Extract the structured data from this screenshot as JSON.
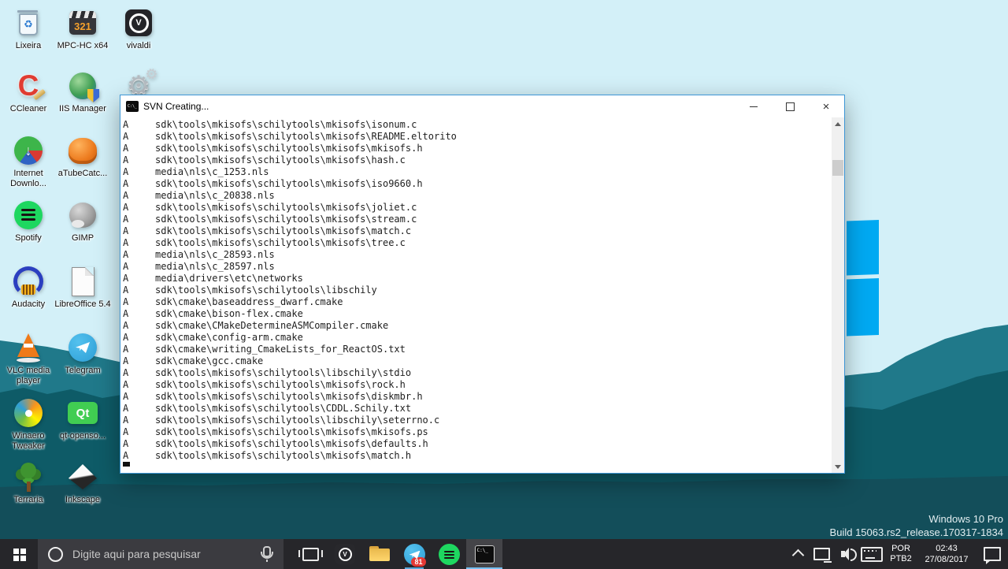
{
  "colors": {
    "sky": "#d3f0f8",
    "hill": "#20798a",
    "forest": "#0e5b67",
    "base": "#134e5a",
    "logo_blue": "#00a9f2",
    "taskbar": "#26262a",
    "window_border": "#3f97d6",
    "badge_red": "#e53935",
    "active_underline": "#76c0f2"
  },
  "desktop": {
    "icons": [
      {
        "id": "lixeira",
        "kind": "bin",
        "col": 0,
        "row": 0,
        "label": "Lixeira",
        "g1": "♻",
        "g2": ""
      },
      {
        "id": "mpc-hc",
        "kind": "clapper",
        "col": 1,
        "row": 0,
        "label": "MPC-HC x64",
        "g1": "",
        "g2": "321"
      },
      {
        "id": "vivaldi",
        "kind": "vivaldi",
        "col": 2,
        "row": 0,
        "label": "vivaldi",
        "g1": "",
        "g2": "V"
      },
      {
        "id": "ccleaner",
        "kind": "ccleaner",
        "col": 0,
        "row": 1,
        "label": "CCleaner",
        "g1": "C",
        "g2": ""
      },
      {
        "id": "iis-manager",
        "kind": "iis",
        "col": 1,
        "row": 1,
        "label": "IIS Manager",
        "g1": "",
        "g2": ""
      },
      {
        "id": "unknown-gears-app",
        "kind": "gears",
        "col": 2,
        "row": 1,
        "label": "",
        "g1": "⚙",
        "g2": "⚙"
      },
      {
        "id": "internet-download",
        "kind": "idm",
        "col": 0,
        "row": 2,
        "label": "Internet Downlo...",
        "g1": "",
        "g2": "↓"
      },
      {
        "id": "atubecatcher",
        "kind": "fist",
        "col": 1,
        "row": 2,
        "label": "aTubeCatc...",
        "g1": "",
        "g2": ""
      },
      {
        "id": "spotify",
        "kind": "spotify",
        "col": 0,
        "row": 3,
        "label": "Spotify",
        "g1": "",
        "g2": ""
      },
      {
        "id": "gimp",
        "kind": "gimp",
        "col": 1,
        "row": 3,
        "label": "GIMP",
        "g1": "",
        "g2": ""
      },
      {
        "id": "audacity",
        "kind": "audacity",
        "col": 0,
        "row": 4,
        "label": "Audacity",
        "g1": "",
        "g2": ""
      },
      {
        "id": "libreoffice",
        "kind": "lodoc",
        "col": 1,
        "row": 4,
        "label": "LibreOffice 5.4",
        "g1": "",
        "g2": ""
      },
      {
        "id": "vlc",
        "kind": "vlc",
        "col": 0,
        "row": 5,
        "label": "VLC media player",
        "g1": "",
        "g2": ""
      },
      {
        "id": "telegram",
        "kind": "telegram",
        "col": 1,
        "row": 5,
        "label": "Telegram",
        "g1": "",
        "g2": ""
      },
      {
        "id": "winaero-tweaker",
        "kind": "winaero",
        "col": 0,
        "row": 6,
        "label": "Winaero Tweaker",
        "g1": "",
        "g2": ""
      },
      {
        "id": "qt-opensource",
        "kind": "qt",
        "col": 1,
        "row": 6,
        "label": "qt-openso...",
        "g1": "",
        "g2": "Qt"
      },
      {
        "id": "terraria",
        "kind": "terraria",
        "col": 0,
        "row": 7,
        "label": "Terraria",
        "g1": "",
        "g2": ""
      },
      {
        "id": "inkscape",
        "kind": "inkscape",
        "col": 1,
        "row": 7,
        "label": "Inkscape",
        "g1": "",
        "g2": ""
      }
    ],
    "watermark": {
      "line1": "Windows 10 Pro",
      "line2": "Build 15063.rs2_release.170317-1834"
    }
  },
  "window": {
    "title": "SVN Creating...",
    "cmd_glyph": "C:\\_",
    "close_glyph": "×",
    "lines": [
      {
        "s": "A",
        "p": "sdk\\tools\\mkisofs\\schilytools\\mkisofs\\isonum.c"
      },
      {
        "s": "A",
        "p": "sdk\\tools\\mkisofs\\schilytools\\mkisofs\\README.eltorito"
      },
      {
        "s": "A",
        "p": "sdk\\tools\\mkisofs\\schilytools\\mkisofs\\mkisofs.h"
      },
      {
        "s": "A",
        "p": "sdk\\tools\\mkisofs\\schilytools\\mkisofs\\hash.c"
      },
      {
        "s": "A",
        "p": "media\\nls\\c_1253.nls"
      },
      {
        "s": "A",
        "p": "sdk\\tools\\mkisofs\\schilytools\\mkisofs\\iso9660.h"
      },
      {
        "s": "A",
        "p": "media\\nls\\c_20838.nls"
      },
      {
        "s": "A",
        "p": "sdk\\tools\\mkisofs\\schilytools\\mkisofs\\joliet.c"
      },
      {
        "s": "A",
        "p": "sdk\\tools\\mkisofs\\schilytools\\mkisofs\\stream.c"
      },
      {
        "s": "A",
        "p": "sdk\\tools\\mkisofs\\schilytools\\mkisofs\\match.c"
      },
      {
        "s": "A",
        "p": "sdk\\tools\\mkisofs\\schilytools\\mkisofs\\tree.c"
      },
      {
        "s": "A",
        "p": "media\\nls\\c_28593.nls"
      },
      {
        "s": "A",
        "p": "media\\nls\\c_28597.nls"
      },
      {
        "s": "A",
        "p": "media\\drivers\\etc\\networks"
      },
      {
        "s": "A",
        "p": "sdk\\tools\\mkisofs\\schilytools\\libschily"
      },
      {
        "s": "A",
        "p": "sdk\\cmake\\baseaddress_dwarf.cmake"
      },
      {
        "s": "A",
        "p": "sdk\\cmake\\bison-flex.cmake"
      },
      {
        "s": "A",
        "p": "sdk\\cmake\\CMakeDetermineASMCompiler.cmake"
      },
      {
        "s": "A",
        "p": "sdk\\cmake\\config-arm.cmake"
      },
      {
        "s": "A",
        "p": "sdk\\cmake\\writing_CmakeLists_for_ReactOS.txt"
      },
      {
        "s": "A",
        "p": "sdk\\cmake\\gcc.cmake"
      },
      {
        "s": "A",
        "p": "sdk\\tools\\mkisofs\\schilytools\\libschily\\stdio"
      },
      {
        "s": "A",
        "p": "sdk\\tools\\mkisofs\\schilytools\\mkisofs\\rock.h"
      },
      {
        "s": "A",
        "p": "sdk\\tools\\mkisofs\\schilytools\\mkisofs\\diskmbr.h"
      },
      {
        "s": "A",
        "p": "sdk\\tools\\mkisofs\\schilytools\\CDDL.Schily.txt"
      },
      {
        "s": "A",
        "p": "sdk\\tools\\mkisofs\\schilytools\\libschily\\seterrno.c"
      },
      {
        "s": "A",
        "p": "sdk\\tools\\mkisofs\\schilytools\\mkisofs\\mkisofs.ps"
      },
      {
        "s": "A",
        "p": "sdk\\tools\\mkisofs\\schilytools\\mkisofs\\defaults.h"
      },
      {
        "s": "A",
        "p": "sdk\\tools\\mkisofs\\schilytools\\mkisofs\\match.h"
      }
    ]
  },
  "taskbar": {
    "search_placeholder": "Digite aqui para pesquisar",
    "telegram_badge": "81",
    "vivaldi_glyph": "V",
    "tray": {
      "lang_top": "POR",
      "lang_bottom": "PTB2",
      "time": "02:43",
      "date": "27/08/2017"
    }
  }
}
